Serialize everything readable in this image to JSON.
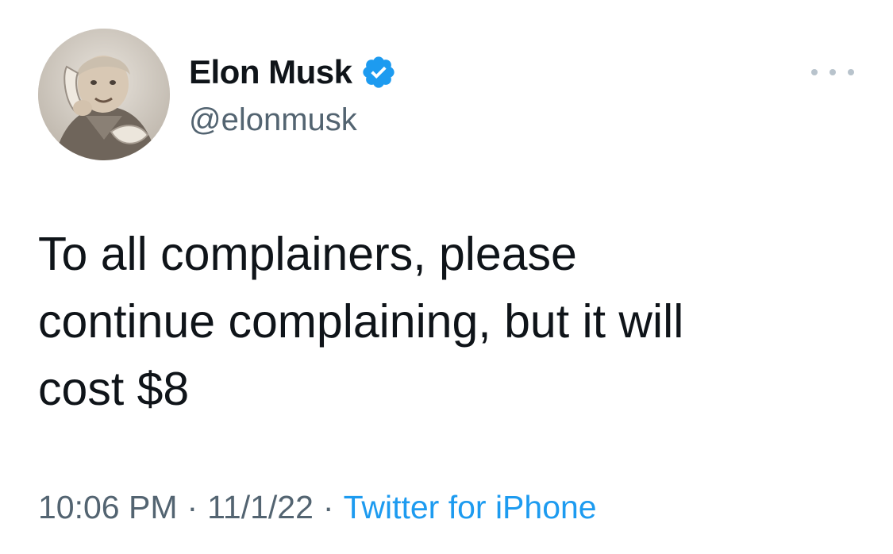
{
  "author": {
    "display_name": "Elon Musk",
    "handle": "@elonmusk",
    "verified": true,
    "verified_color": "#1d9bf0"
  },
  "tweet": {
    "text_lines": [
      "To all complainers, please",
      "continue complaining, but it will",
      "cost $8"
    ],
    "time": "10:06 PM",
    "separator": "·",
    "date": "11/1/22",
    "source": "Twitter for iPhone"
  },
  "icons": {
    "more": "more-horizontal-icon",
    "verified": "verified-badge-icon"
  },
  "colors": {
    "text": "#0f1419",
    "secondary": "#536471",
    "link": "#1d9bf0"
  }
}
